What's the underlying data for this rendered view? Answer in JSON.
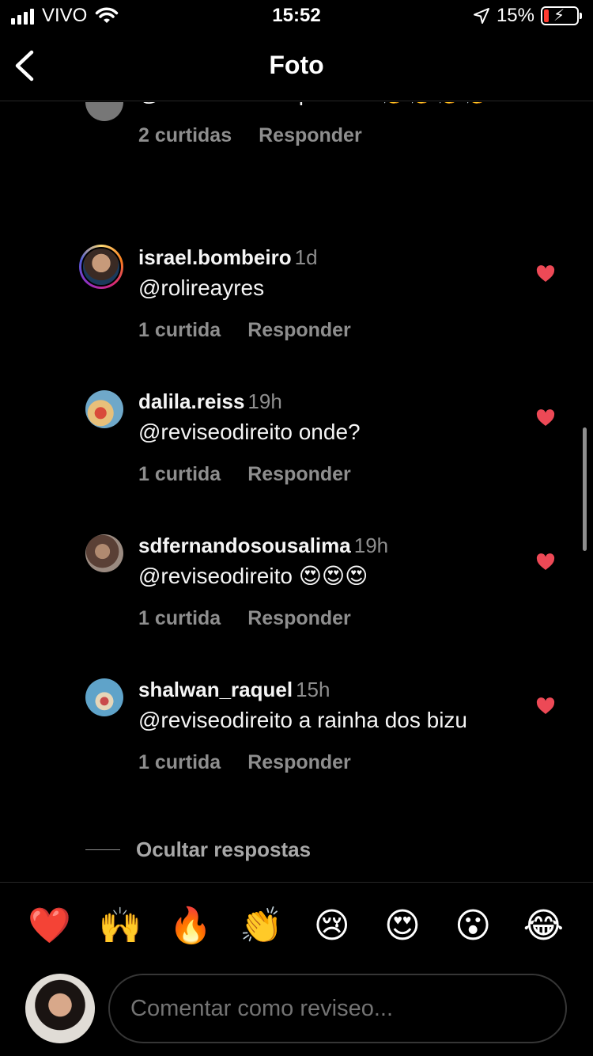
{
  "status_bar": {
    "carrier": "VIVO",
    "time": "15:52",
    "battery_percent": "15%",
    "battery_level": 0.15,
    "icons": [
      "signal-icon",
      "wifi-icon",
      "location-arrow-icon",
      "battery-charging-icon"
    ]
  },
  "nav": {
    "title": "Foto",
    "back_icon": "chevron-left-icon"
  },
  "comments": [
    {
      "username": "",
      "time": "",
      "text": "@reviseodireito perfeito 👏👏👏👏",
      "likes": "2 curtidas",
      "reply": "Responder",
      "liked": true
    },
    {
      "username": "israel.bombeiro",
      "time": "1d",
      "text": "@rolireayres",
      "likes": "1 curtida",
      "reply": "Responder",
      "liked": true
    },
    {
      "username": "dalila.reiss",
      "time": "19h",
      "text": "@reviseodireito onde?",
      "likes": "1 curtida",
      "reply": "Responder",
      "liked": true
    },
    {
      "username": "sdfernandosousalima",
      "time": "19h",
      "text": "@reviseodireito 😍😍😍",
      "likes": "1 curtida",
      "reply": "Responder",
      "liked": true
    },
    {
      "username": "shalwan_raquel",
      "time": "15h",
      "text": "@reviseodireito a rainha dos bizu",
      "likes": "1 curtida",
      "reply": "Responder",
      "liked": true
    }
  ],
  "hide_replies": "Ocultar respostas",
  "quick_emojis": [
    "❤️",
    "🙌",
    "🔥",
    "👏",
    "😢",
    "😍",
    "😮",
    "😂"
  ],
  "comment_input": {
    "placeholder": "Comentar como reviseo..."
  },
  "colors": {
    "background": "#000000",
    "secondary_text": "#8e8e8e",
    "heart": "#ed4956",
    "border": "#363636"
  }
}
